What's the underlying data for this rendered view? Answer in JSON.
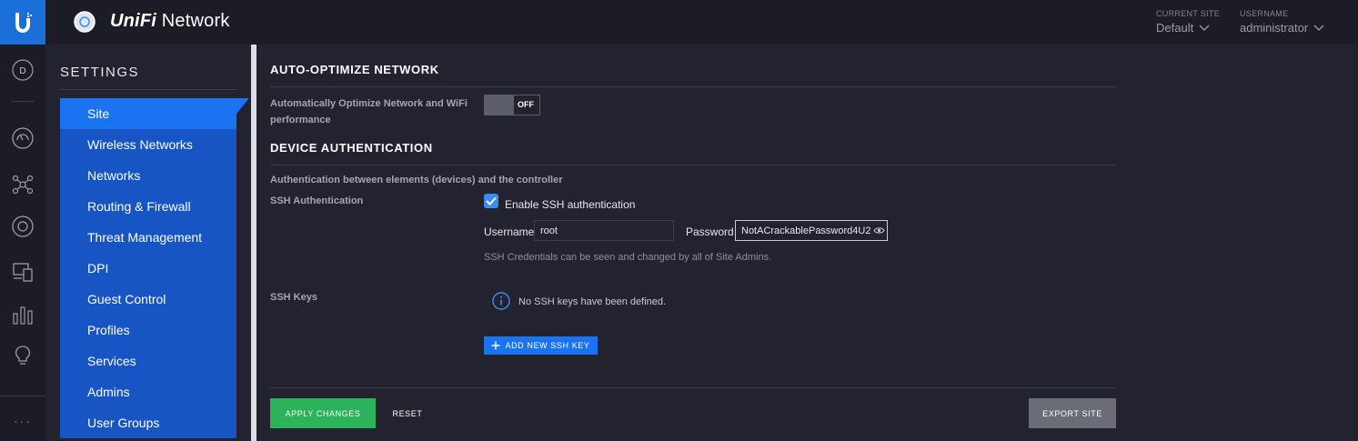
{
  "header": {
    "brand_name": "UniFi",
    "brand_suffix": "Network",
    "site_label": "CURRENT SITE",
    "site_value": "Default",
    "user_label": "USERNAME",
    "user_value": "administrator"
  },
  "rail": {
    "avatar_letter": "D",
    "icons": [
      "dashboard-icon",
      "topology-icon",
      "devices-icon",
      "clients-icon",
      "statistics-icon",
      "insights-icon"
    ],
    "more": "···"
  },
  "settings": {
    "title": "SETTINGS",
    "items": [
      {
        "label": "Site",
        "active": true
      },
      {
        "label": "Wireless Networks"
      },
      {
        "label": "Networks"
      },
      {
        "label": "Routing & Firewall"
      },
      {
        "label": "Threat Management"
      },
      {
        "label": "DPI"
      },
      {
        "label": "Guest Control"
      },
      {
        "label": "Profiles"
      },
      {
        "label": "Services"
      },
      {
        "label": "Admins"
      },
      {
        "label": "User Groups"
      }
    ]
  },
  "auto_optimize": {
    "heading": "AUTO-OPTIMIZE NETWORK",
    "label_line1": "Automatically Optimize Network and WiFi",
    "label_line2": "performance",
    "toggle_state": "OFF"
  },
  "device_auth": {
    "heading": "DEVICE AUTHENTICATION",
    "description": "Authentication between elements (devices) and the controller",
    "ssh_label": "SSH Authentication",
    "enable_ssh_label": "Enable SSH authentication",
    "enable_ssh_checked": true,
    "username_label": "Username",
    "username_value": "root",
    "password_label": "Password",
    "password_value": "NotACrackablePassword4U2",
    "help_text": "SSH Credentials can be seen and changed by all of Site Admins.",
    "ssh_keys_label": "SSH Keys",
    "no_keys_text": "No SSH keys have been defined.",
    "add_key_label": "ADD NEW SSH KEY"
  },
  "actions": {
    "apply": "APPLY CHANGES",
    "reset": "RESET",
    "export": "EXPORT SITE"
  },
  "colors": {
    "accent": "#1a73f0",
    "nav_blue": "#1755c4",
    "apply_green": "#2ab35a",
    "background": "#22232f"
  }
}
